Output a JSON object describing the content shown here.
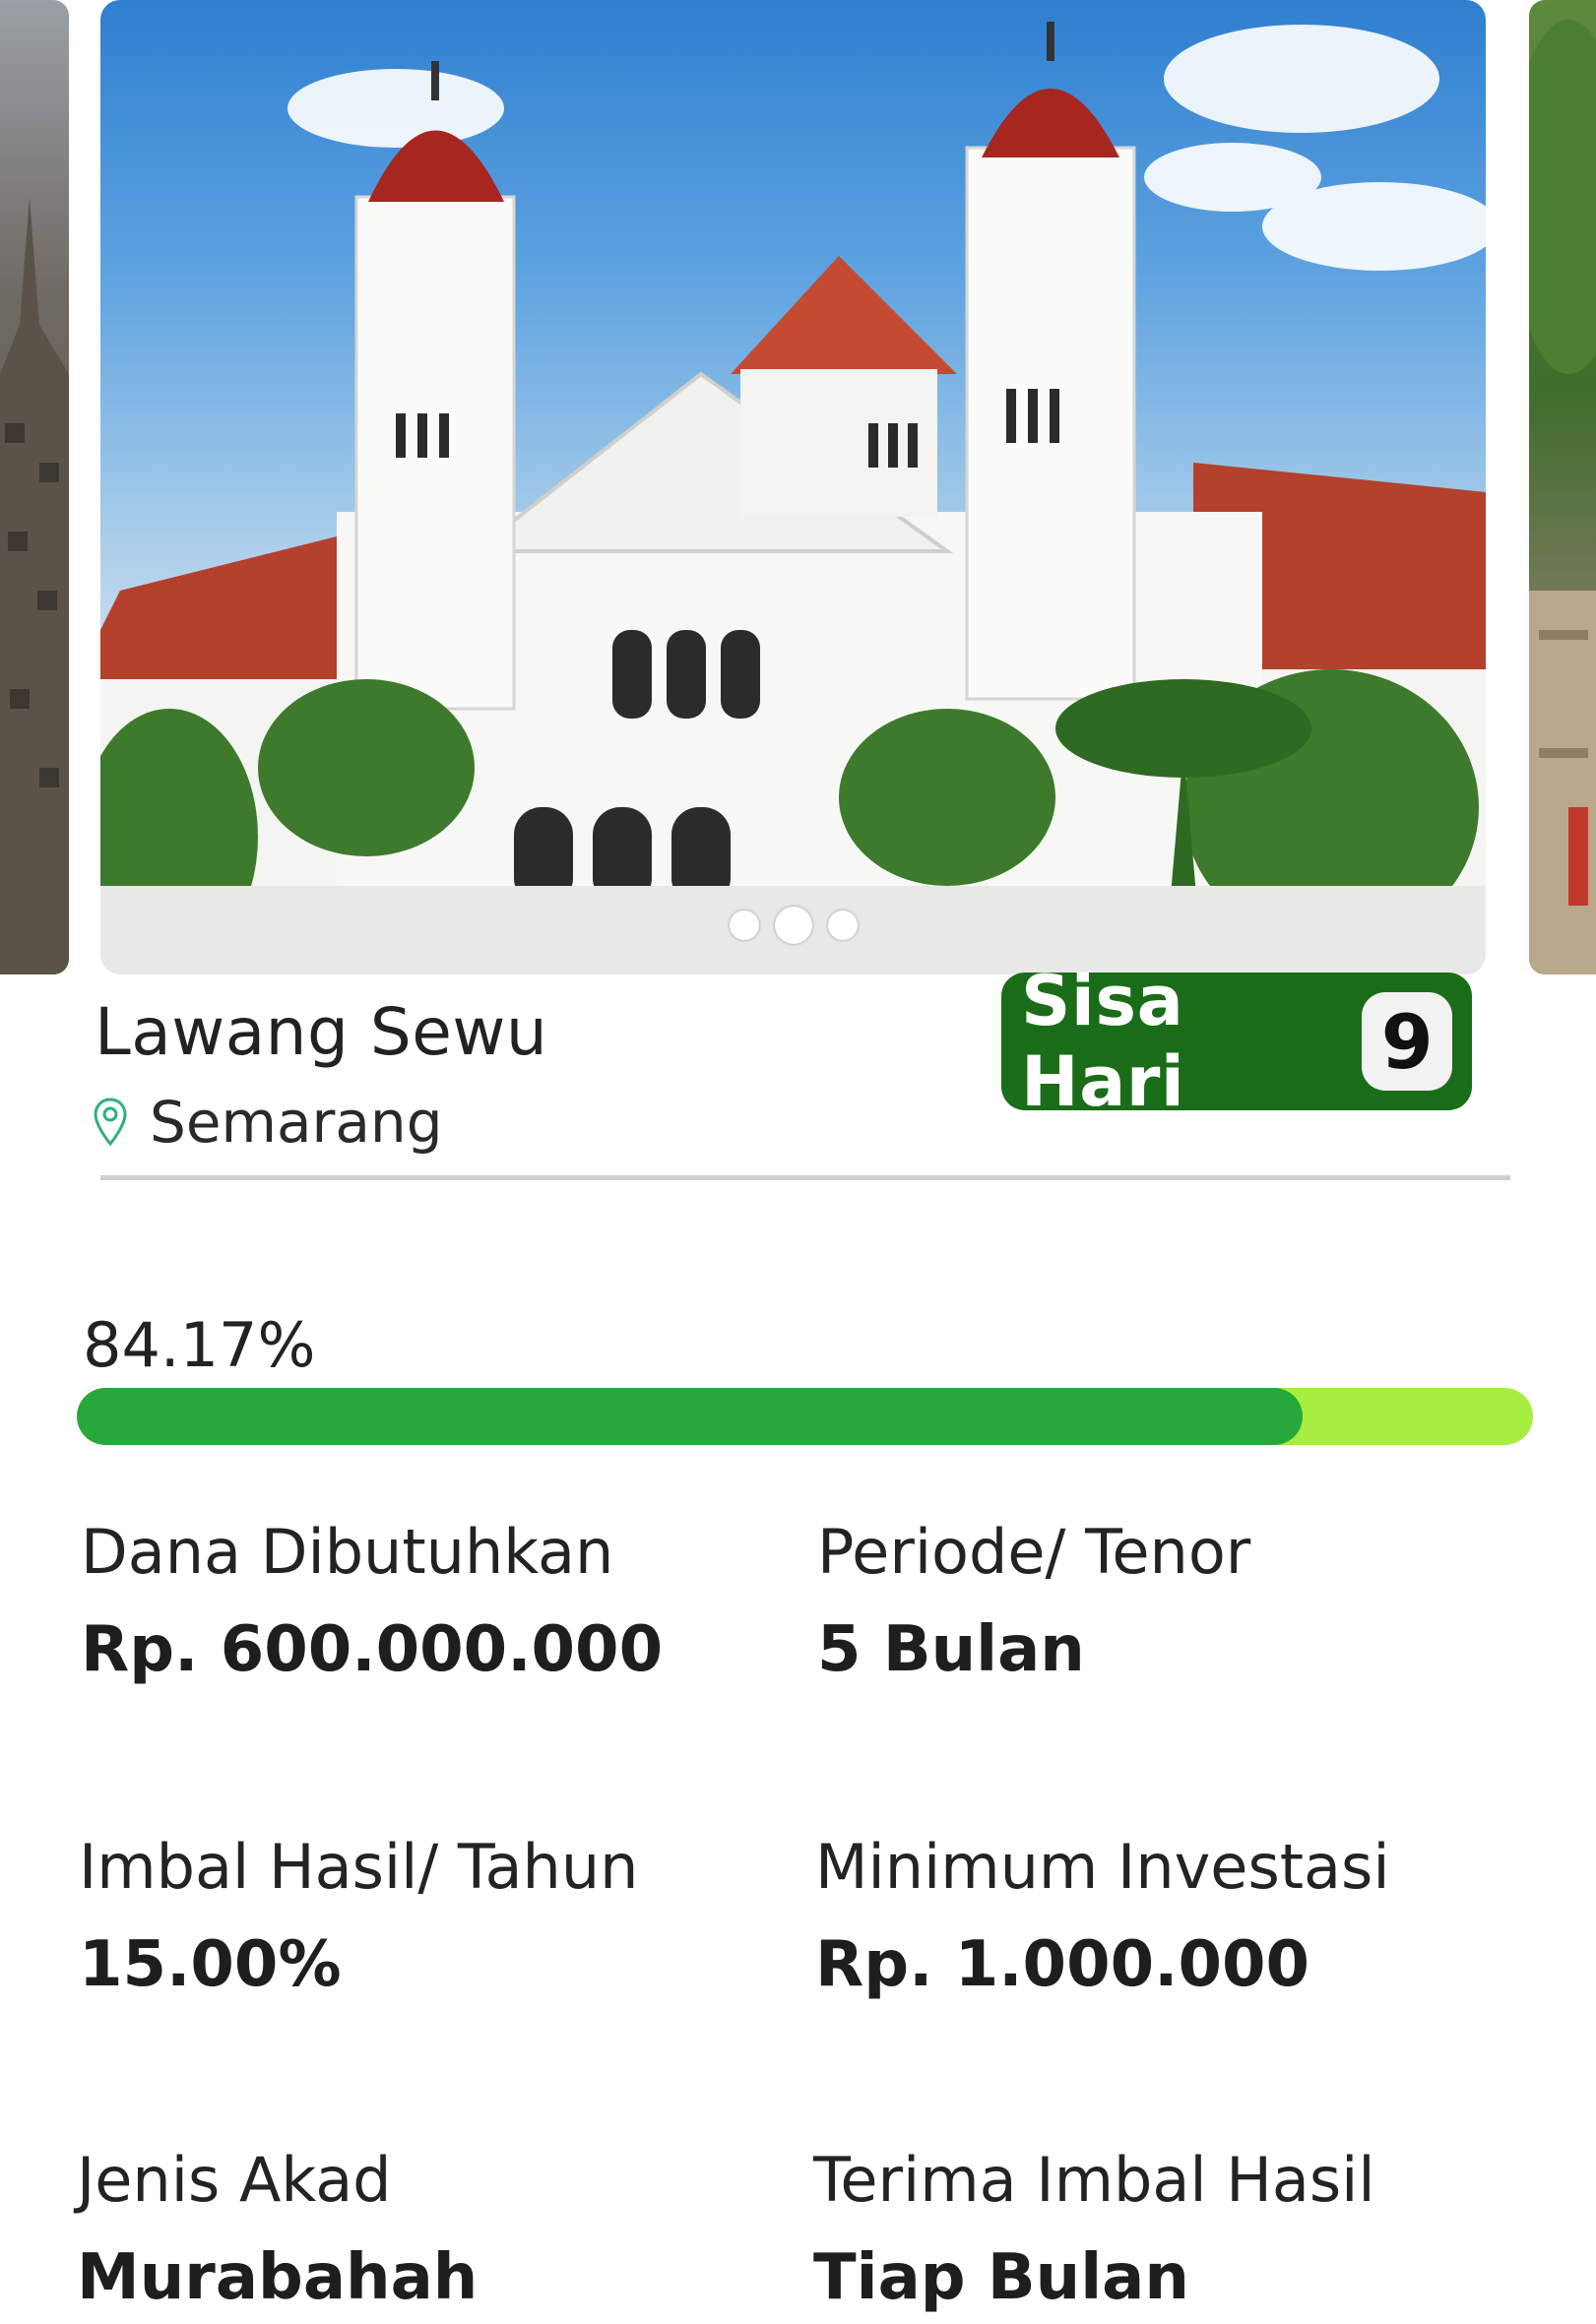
{
  "carousel": {
    "slide_count": 3,
    "active_index": 1
  },
  "project": {
    "title": "Lawang Sewu",
    "location": "Semarang",
    "sisa_hari_label": "Sisa Hari",
    "sisa_hari_value": "9"
  },
  "progress": {
    "label": "84.17%",
    "fraction": 0.8417
  },
  "stats": [
    {
      "label": "Dana Dibutuhkan",
      "value": "Rp. 600.000.000"
    },
    {
      "label": "Periode/ Tenor",
      "value": "5 Bulan"
    },
    {
      "label": "Imbal Hasil/ Tahun",
      "value": "15.00%"
    },
    {
      "label": "Minimum Investasi",
      "value": "Rp. 1.000.000"
    },
    {
      "label": "Jenis Akad",
      "value": "Murabahah"
    },
    {
      "label": "Terima Imbal Hasil",
      "value": "Tiap Bulan"
    }
  ],
  "colors": {
    "badge_green": "#1a6d18",
    "progress_fill": "#26a83a",
    "progress_track": "#a8ee40",
    "location_pin": "#2fb07a"
  },
  "icons": {
    "location": "map-pin-icon"
  }
}
